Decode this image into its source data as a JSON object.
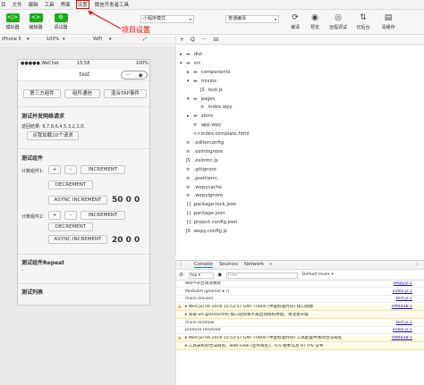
{
  "menubar": {
    "items": [
      "目",
      "文件",
      "编辑",
      "工具",
      "界面",
      "设置",
      "微信开发者工具"
    ]
  },
  "toolbar": {
    "left_buttons": [
      {
        "glyph": "</>",
        "label": "模拟器"
      },
      {
        "glyph": "<>",
        "label": "编辑器"
      },
      {
        "glyph": "⚙",
        "label": "调试器"
      }
    ],
    "mode_select": "小程序模式",
    "compile_select": "普通编译",
    "right_buttons": [
      {
        "glyph": "⟳",
        "label": "编译"
      },
      {
        "glyph": "◉",
        "label": "预览"
      },
      {
        "glyph": "◎",
        "label": "远程调试"
      },
      {
        "glyph": "⇅",
        "label": "切后台"
      },
      {
        "glyph": "▤",
        "label": "清缓存"
      }
    ]
  },
  "annotation": {
    "text": "项目设置"
  },
  "devicebar": {
    "device": "iPhone 5",
    "zoom": "100%",
    "network": "WiFi"
  },
  "simulator": {
    "status_left": "●●●●● WeChat",
    "status_time": "15:58",
    "status_right": "100%",
    "nav_title": "test",
    "capsule_dots": "···",
    "capsule_circle": "◉",
    "top_buttons": [
      "第三方组件",
      "组件通信",
      "混合TAP事件"
    ],
    "section1": {
      "title": "测试并发网络请求",
      "result": "返回结果: 9,7,8,6,4,5,3,2,1,0,",
      "button": "点我加载10个请求"
    },
    "section2": {
      "title": "测试组件",
      "counter1_label": "计数组件1:",
      "counter2_label": "计数组件2:",
      "plus": "+",
      "minus": "-",
      "increment": "INCREMENT",
      "decrement": "DECREMENT",
      "async_increment": "ASYNC INCREMENT",
      "value1": "50 0 0",
      "value2": "20 0 0"
    },
    "section3": {
      "title": "测试组件Repeat",
      "dash": "-"
    },
    "section4": {
      "title": "测试列表"
    }
  },
  "tree_toolbar": {
    "plus": "+",
    "search": "Q",
    "more": "···",
    "split": "⊟"
  },
  "file_tree": [
    {
      "type": "folder",
      "name": "dist",
      "depth": 0,
      "arrow": "▸"
    },
    {
      "type": "folder",
      "name": "src",
      "depth": 0,
      "arrow": "▾"
    },
    {
      "type": "folder",
      "name": "components",
      "depth": 1,
      "arrow": "▸"
    },
    {
      "type": "folder",
      "name": "mixins",
      "depth": 1,
      "arrow": "▾"
    },
    {
      "type": "file",
      "name": "test.js",
      "depth": 2,
      "icon": "JS"
    },
    {
      "type": "folder",
      "name": "pages",
      "depth": 1,
      "arrow": "▾"
    },
    {
      "type": "file",
      "name": "index.wpy",
      "depth": 2,
      "icon": "≡"
    },
    {
      "type": "folder",
      "name": "store",
      "depth": 1,
      "arrow": "▸"
    },
    {
      "type": "file",
      "name": "app.wpy",
      "depth": 1,
      "icon": "≡"
    },
    {
      "type": "file",
      "name": "index.template.html",
      "depth": 1,
      "icon": "<>"
    },
    {
      "type": "file",
      "name": ".editorconfig",
      "depth": 0,
      "icon": "≡"
    },
    {
      "type": "file",
      "name": ".eslintignore",
      "depth": 0,
      "icon": "≡"
    },
    {
      "type": "file",
      "name": ".eslintrc.js",
      "depth": 0,
      "icon": "JS"
    },
    {
      "type": "file",
      "name": ".gitignore",
      "depth": 0,
      "icon": "≡"
    },
    {
      "type": "file",
      "name": ".prettierrc",
      "depth": 0,
      "icon": "≡"
    },
    {
      "type": "file",
      "name": ".wepycache",
      "depth": 0,
      "icon": "≡"
    },
    {
      "type": "file",
      "name": ".wepyignore",
      "depth": 0,
      "icon": "≡"
    },
    {
      "type": "file",
      "name": "package-lock.json",
      "depth": 0,
      "icon": "{}"
    },
    {
      "type": "file",
      "name": "package.json",
      "depth": 0,
      "icon": "{}"
    },
    {
      "type": "file",
      "name": "project.config.json",
      "depth": 0,
      "icon": "{}"
    },
    {
      "type": "file",
      "name": "wepy.config.js",
      "depth": 0,
      "icon": "JS"
    }
  ],
  "console": {
    "tabs": [
      "Console",
      "Sources",
      "Network",
      "»"
    ],
    "context_select": "top",
    "filter_placeholder": "Filter",
    "levels_select": "Default levels",
    "rows": [
      {
        "text": "WePY开启调试模式",
        "src": "wepy.js:1",
        "warn": false
      },
      {
        "text": "ModuleA ignored:  ▸ []",
        "src": "index.js:1",
        "warn": false
      },
      {
        "text": "mixin onLoad",
        "src": "test.js:1",
        "warn": false
      },
      {
        "text": "▸ Wed Jul 04 2018 15:53:57 GMT+0800 (中国标准时间) 接口调整",
        "src": "VM4838:1",
        "warn": true
      },
      {
        "text": "  ▸ 获取 wx.getUserInfo 接口后续将不再出现授权弹窗，请注意升级",
        "src": "",
        "warn": true
      },
      {
        "text": "mixin onShow",
        "src": "test.js:1",
        "warn": false
      },
      {
        "text": "promise resolved",
        "src": "index.js:1",
        "warn": false
      },
      {
        "text": "▸ Wed Jul 04 2018 15:53:57 GMT+0800 (中国标准时间) 工具配置中关闭合法域名",
        "src": "VM4838:1",
        "warn": true
      },
      {
        "text": "  ▸ 工具未校验合法域名、web-view (业务域名)、TLS 版本以及 HTTPS 证书",
        "src": "",
        "warn": true
      }
    ]
  }
}
